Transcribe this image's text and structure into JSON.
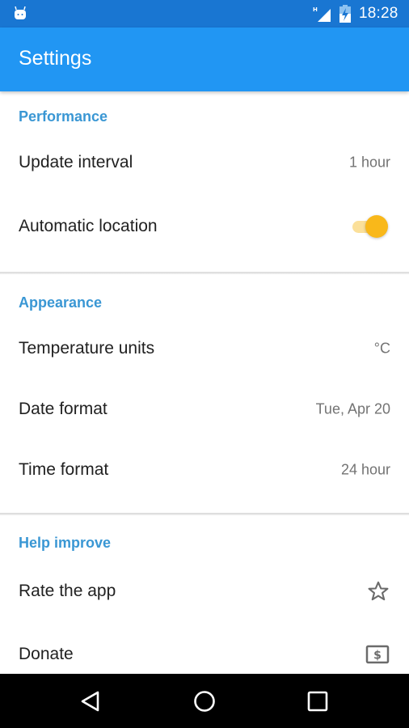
{
  "status_bar": {
    "time": "18:28",
    "network_type": "H",
    "icons": [
      "android-notification-icon",
      "signal-icon",
      "battery-charging-icon"
    ]
  },
  "app_bar": {
    "title": "Settings"
  },
  "sections": [
    {
      "header": "Performance",
      "items": [
        {
          "label": "Update interval",
          "value": "1 hour"
        },
        {
          "label": "Automatic location",
          "toggle": true
        }
      ]
    },
    {
      "header": "Appearance",
      "items": [
        {
          "label": "Temperature units",
          "value": "°C"
        },
        {
          "label": "Date format",
          "value": "Tue, Apr 20"
        },
        {
          "label": "Time format",
          "value": "24 hour"
        }
      ]
    },
    {
      "header": "Help improve",
      "items": [
        {
          "label": "Rate the app",
          "icon": "star-outline-icon"
        },
        {
          "label": "Donate",
          "icon": "dollar-bill-icon"
        }
      ]
    }
  ],
  "nav_bar": {
    "buttons": [
      "back",
      "home",
      "recents"
    ]
  },
  "colors": {
    "status_bar": "#1976d2",
    "app_bar": "#2196f3",
    "section_header": "#3a97d4",
    "toggle_thumb": "#f9b81a",
    "toggle_track": "#fbe09a"
  }
}
